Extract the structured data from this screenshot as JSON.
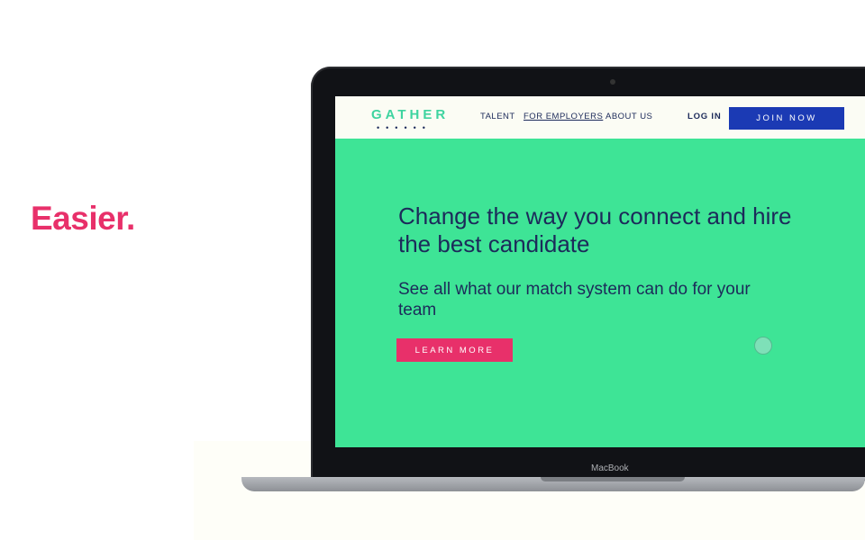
{
  "tagline": "Easier.",
  "device": {
    "brand_label": "MacBook"
  },
  "site": {
    "logo": "GATHER",
    "logo_dots": "••••••",
    "nav": {
      "links": [
        "TALENT",
        "FOR EMPLOYERS",
        "ABOUT US"
      ],
      "login": "LOG IN",
      "join": "JOIN NOW"
    },
    "hero": {
      "headline": "Change the way you connect and hire the best candidate",
      "subhead": "See all what our match system can do for your team",
      "cta": "LEARN MORE"
    }
  },
  "colors": {
    "accent_pink": "#e8306a",
    "hero_green": "#3ee496",
    "navy": "#1c2a5a",
    "button_blue": "#1b3ab4"
  }
}
